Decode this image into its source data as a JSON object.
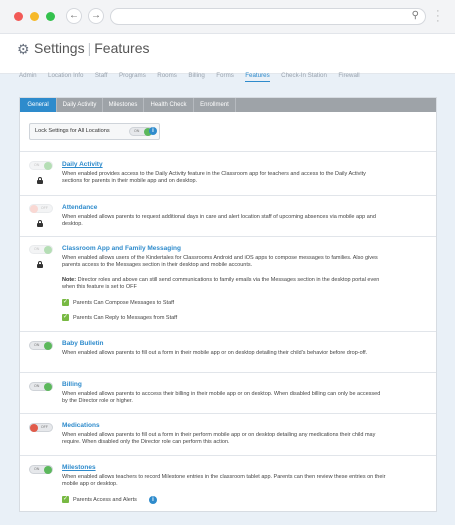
{
  "header": {
    "title": "Settings",
    "subtitle": "Features",
    "nav": [
      "Admin",
      "Location Info",
      "Staff",
      "Programs",
      "Rooms",
      "Billing",
      "Forms",
      "Features",
      "Check-In Station",
      "Firewall"
    ],
    "active_nav": "Features"
  },
  "tabs": [
    "General",
    "Daily Activity",
    "Milestones",
    "Health Check",
    "Enrollment"
  ],
  "active_tab": "General",
  "lock_all": {
    "label": "Lock Settings for All Locations",
    "toggle": "ON"
  },
  "sections": [
    {
      "title": "Daily Activity",
      "toggle": "ON",
      "locked": true,
      "desc": "When enabled provides access to the Daily Activity feature in the Classroom app for teachers and access to the Daily Activity sections for parents in their mobile app and on desktop."
    },
    {
      "title": "Attendance",
      "toggle": "OFF",
      "locked": true,
      "desc": "When enabled allows parents to request additional days in care and alert location staff of upcoming absences via mobile app and desktop."
    },
    {
      "title": "Classroom App and Family Messaging",
      "toggle": "ON",
      "locked": true,
      "desc": "When enabled allows users of the Kindertales for Classrooms Android and iOS apps to compose messages to families. Also gives parents access to the Messages section in their desktop and mobile accounts.",
      "note_label": "Note:",
      "note": "Director roles and above can still send communications to family emails via the Messages section in the desktop portal even when this feature is set to OFF",
      "checks": [
        "Parents Can Compose Messages to Staff",
        "Parents Can Reply to Messages from Staff"
      ]
    },
    {
      "title": "Baby Bulletin",
      "toggle": "ON",
      "locked": false,
      "desc": "When enabled allows parents to fill out a form in their mobile app or on desktop detailing their child's behavior before drop-off."
    },
    {
      "title": "Billing",
      "toggle": "ON",
      "locked": false,
      "desc": "When enabled allows parents to acccess their billing in their mobile app or on desktop. When disabled billing can only be accessed by the Director role or higher."
    },
    {
      "title": "Medications",
      "toggle": "OFF",
      "locked": false,
      "desc": "When enabled allows parents to fill out a form in their perform mobile app or on desktop detailing any medications their child may require. When disabled only the Director role can perform this action."
    },
    {
      "title": "Milestones",
      "toggle": "ON",
      "locked": false,
      "desc": "When enabled allows teachers to record Milestone entries in the classroom tablet app. Parents can then review these entries on their mobile app or desktop.",
      "checks": [
        "Parents Access and Alerts"
      ]
    }
  ]
}
